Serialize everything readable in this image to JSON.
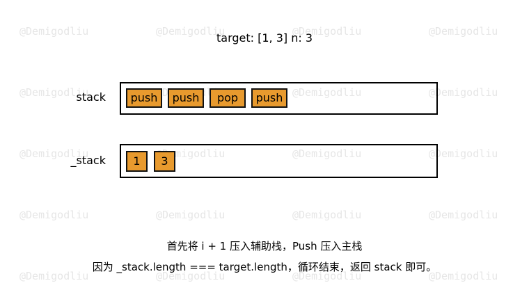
{
  "watermark": "@Demigodliu",
  "title": "target: [1,  3]    n: 3",
  "stack": {
    "label": "stack",
    "items": [
      "push",
      "push",
      "pop",
      "push"
    ]
  },
  "aux_stack": {
    "label": "_stack",
    "items": [
      "1",
      "3"
    ]
  },
  "captions": [
    "首先将 i + 1 压入辅助栈，Push 压入主栈",
    "因为 _stack.length === target.length，循环结束，返回 stack 即可。"
  ],
  "colors": {
    "cell": "#e89a2e",
    "watermark": "#e6e6e6"
  }
}
